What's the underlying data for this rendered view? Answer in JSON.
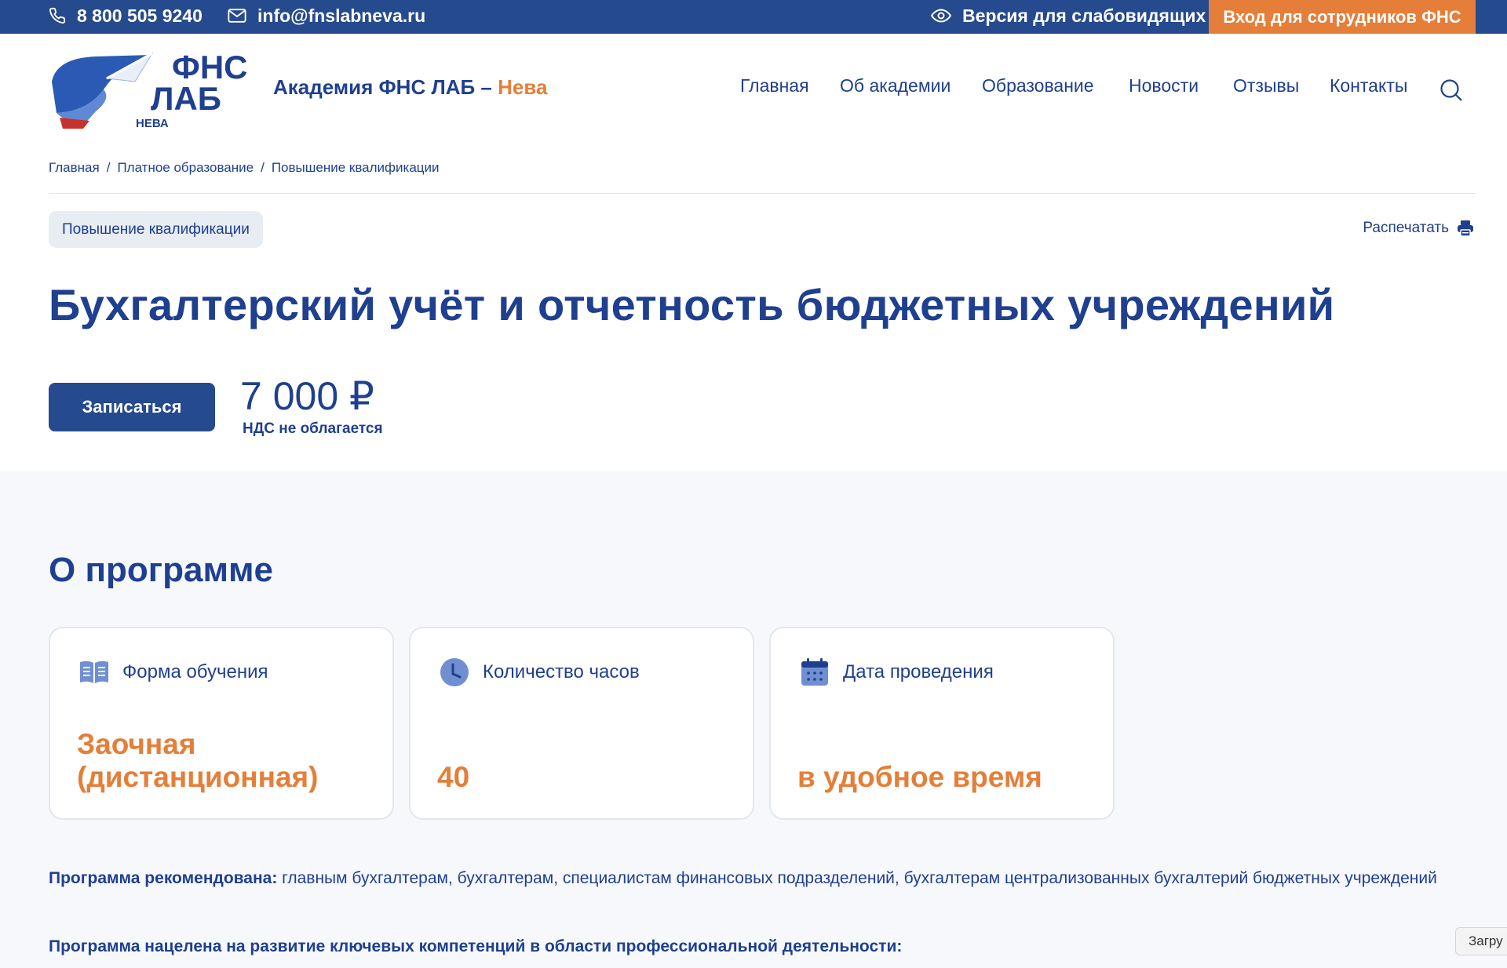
{
  "topbar": {
    "phone": "8 800 505 9240",
    "email": "info@fnslabneva.ru",
    "vision": "Версия для слабовидящих",
    "login": "Вход для сотрудников ФНС"
  },
  "logo": {
    "line1": "ФНС",
    "line2": "ЛАБ",
    "line3": "НЕВА"
  },
  "header": {
    "academy": "Академия ФНС ЛАБ – ",
    "academy_accent": "Нева",
    "nav": [
      "Главная",
      "Об академии",
      "Образование",
      "Новости",
      "Отзывы",
      "Контакты"
    ]
  },
  "breadcrumb": {
    "items": [
      "Главная",
      "Платное образование",
      "Повышение квалификации"
    ],
    "separator": "/"
  },
  "tag": "Повышение квалификации",
  "print_label": "Распечатать",
  "title": "Бухгалтерский учёт и отчетность бюджетных учреждений",
  "enroll_label": "Записаться",
  "price": "7 000 ₽",
  "vat_note": "НДС не облагается",
  "about": {
    "title": "О программе",
    "cards": [
      {
        "icon": "book-icon",
        "label": "Форма обучения",
        "value_line1": "Заочная",
        "value_line2": "(дистанционная)"
      },
      {
        "icon": "clock-icon",
        "label": "Количество часов",
        "value_line1": "40",
        "value_line2": ""
      },
      {
        "icon": "calendar-icon",
        "label": "Дата проведения",
        "value_line1": "в удобное время",
        "value_line2": ""
      }
    ],
    "recommended_label": "Программа рекомендована:",
    "recommended_text": " главным бухгалтерам, бухгалтерам, специалистам финансовых подразделений, бухгалтерам централизованных бухгалтерий бюджетных учреждений",
    "aimed_label": "Программа нацелена на развитие ключевых компетенций в области профессиональной деятельности:"
  },
  "loading_pill": "Загру",
  "colors": {
    "primary": "#254a8d",
    "text": "#1f3f8f",
    "accent": "#e57e38",
    "section_bg": "#f6f8fc"
  }
}
